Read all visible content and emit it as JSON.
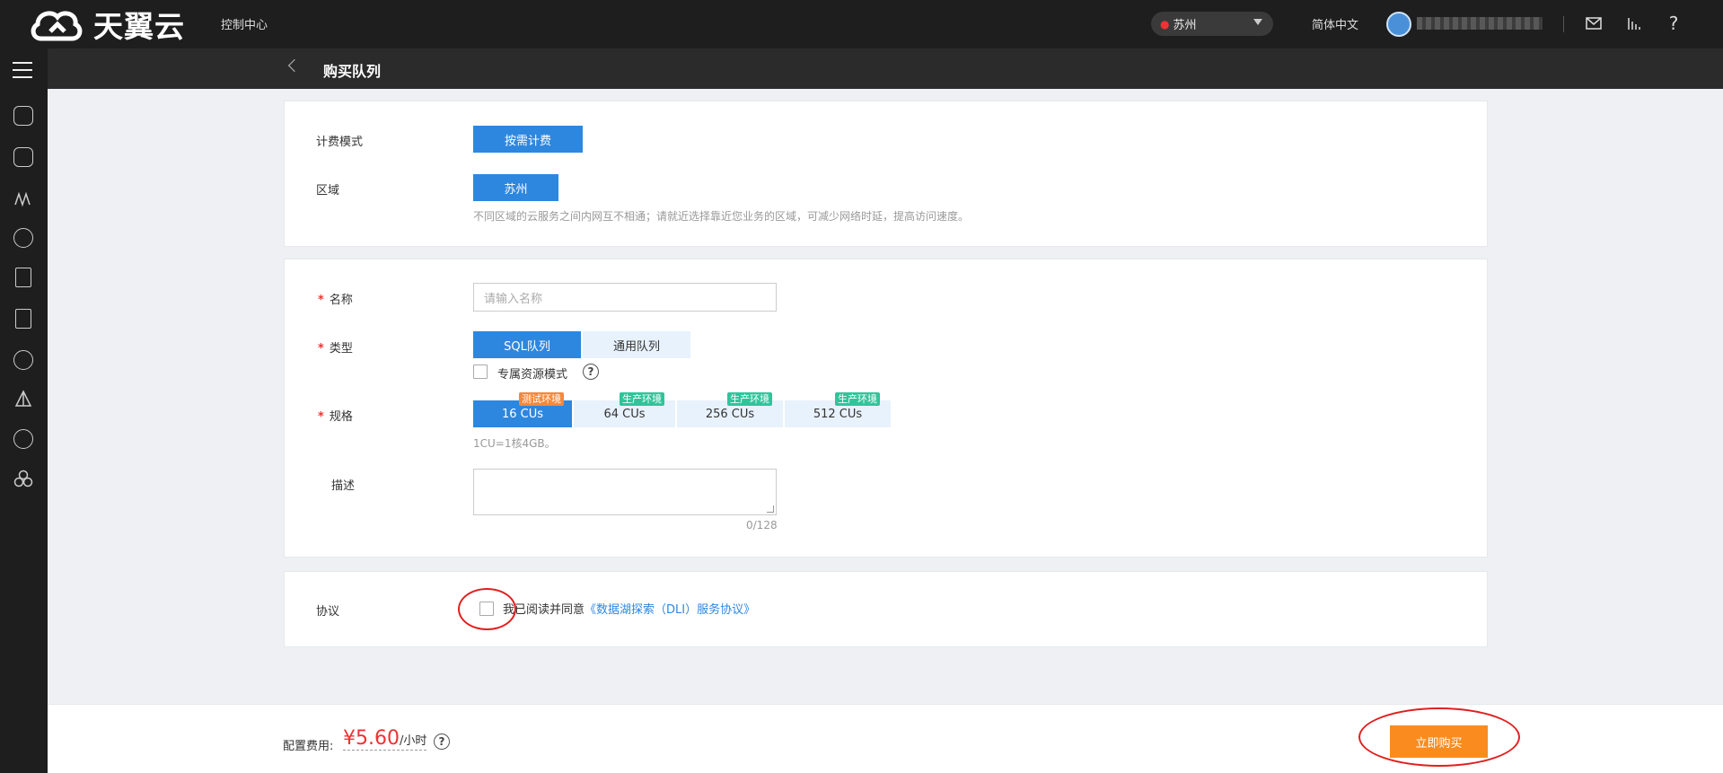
{
  "header": {
    "logo_text": "天翼云",
    "console": "控制中心",
    "region": "苏州",
    "language": "简体中文"
  },
  "subheader": {
    "title": "购买队列"
  },
  "billing": {
    "label": "计费模式",
    "mode": "按需计费",
    "region_label": "区域",
    "region": "苏州",
    "region_hint": "不同区域的云服务之间内网互不相通；请就近选择靠近您业务的区域，可减少网络时延，提高访问速度。"
  },
  "form": {
    "name_label": "名称",
    "name_placeholder": "请输入名称",
    "type_label": "类型",
    "types": [
      "SQL队列",
      "通用队列"
    ],
    "dedicated_label": "专属资源模式",
    "spec_label": "规格",
    "specs": [
      {
        "label": "16 CUs",
        "tag": "测试环境"
      },
      {
        "label": "64 CUs",
        "tag": "生产环境"
      },
      {
        "label": "256 CUs",
        "tag": "生产环境"
      },
      {
        "label": "512 CUs",
        "tag": "生产环境"
      }
    ],
    "spec_hint": "1CU=1核4GB。",
    "desc_label": "描述",
    "desc_counter": "0/128"
  },
  "agreement": {
    "label": "协议",
    "text": "我已阅读并同意",
    "link": "《数据湖探索（DLI）服务协议》"
  },
  "footer": {
    "fee_label": "配置费用:",
    "price": "¥5.60",
    "unit": "/小时",
    "buy_button": "立即购买"
  },
  "help_glyph": "?",
  "colors": {
    "primary": "#2e87de",
    "buy": "#fa8c1f",
    "price": "#e33333",
    "test_tag": "#f5883a",
    "prod_tag": "#2fc59b"
  }
}
